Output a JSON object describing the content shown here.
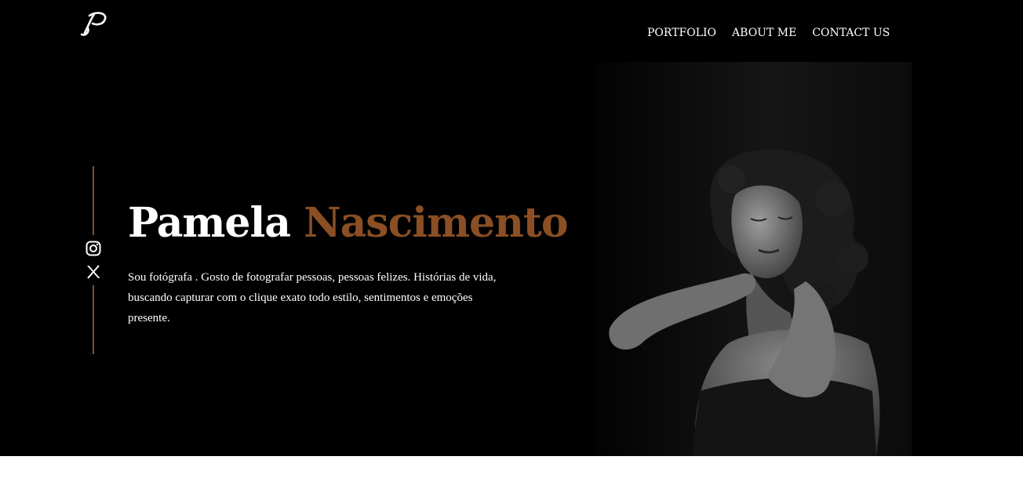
{
  "header": {
    "logo_icon": "script-p-logo-icon",
    "nav": [
      {
        "label": "PORTFOLIO"
      },
      {
        "label": "ABOUT ME"
      },
      {
        "label": "CONTACT US"
      }
    ]
  },
  "hero": {
    "first_name": "Pamela",
    "last_name": "Nascimento",
    "bio": "Sou fotógrafa . Gosto de fotografar pessoas, pessoas felizes. Histórias de vida, buscando capturar com o clique exato todo estilo, sentimentos e emoções presente.",
    "socials": [
      {
        "icon": "instagram-icon"
      },
      {
        "icon": "x-twitter-icon"
      }
    ],
    "accent_color": "#8a4f24",
    "photo": "black-and-white-portrait"
  },
  "colors": {
    "background": "#000000",
    "text": "#ffffff",
    "accent": "#8a4f24",
    "footer": "#ffffff"
  }
}
